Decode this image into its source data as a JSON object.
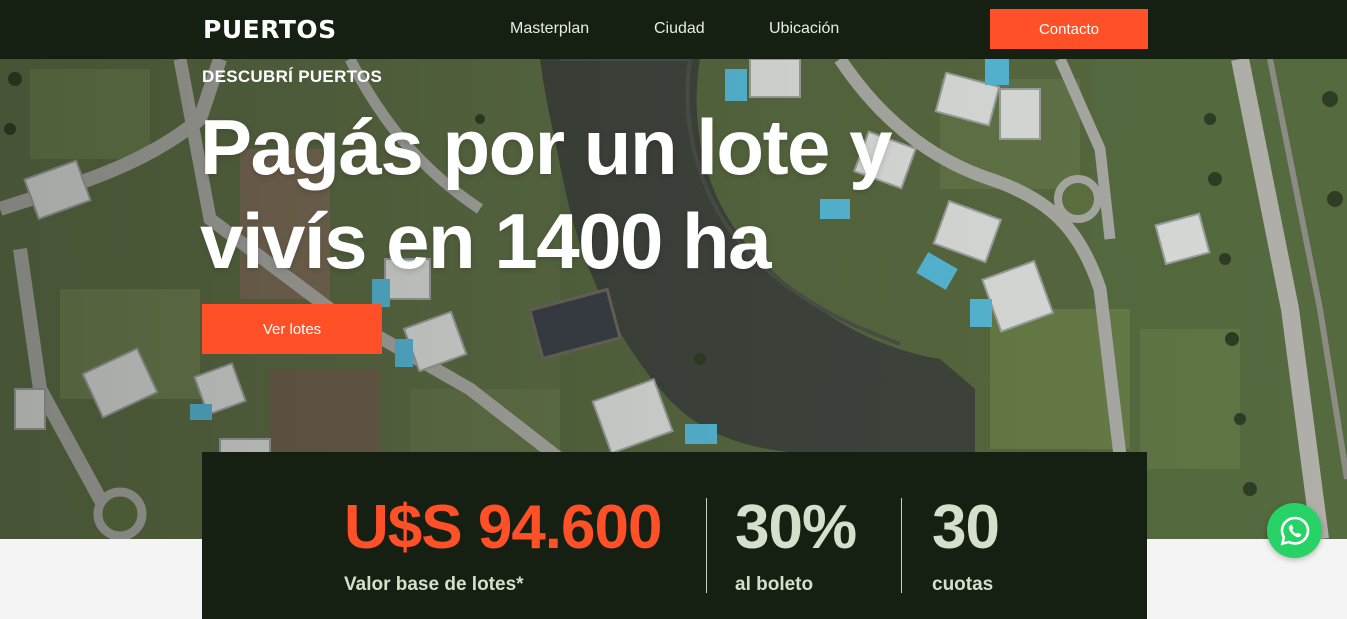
{
  "header": {
    "logo": "PUERTOS",
    "nav": [
      {
        "label": "Masterplan"
      },
      {
        "label": "Ciudad"
      },
      {
        "label": "Ubicación"
      }
    ],
    "contact_label": "Contacto"
  },
  "hero": {
    "eyebrow": "DESCUBRÍ PUERTOS",
    "headline_line1": "Pagás por un lote y",
    "headline_line2": "vivís en 1400 ha",
    "cta_label": "Ver lotes"
  },
  "stats": [
    {
      "value": "U$S 94.600",
      "label": "Valor base de lotes*",
      "color": "#ff5027"
    },
    {
      "value": "30%",
      "label": "al boleto",
      "color": "#d5dfcb"
    },
    {
      "value": "30",
      "label": "cuotas",
      "color": "#d5dfcb"
    }
  ],
  "colors": {
    "brand_dark": "#162012",
    "accent": "#ff5027",
    "stat_light": "#d5dfcb",
    "whatsapp": "#27d366"
  },
  "icons": {
    "floating": "whatsapp-icon"
  }
}
